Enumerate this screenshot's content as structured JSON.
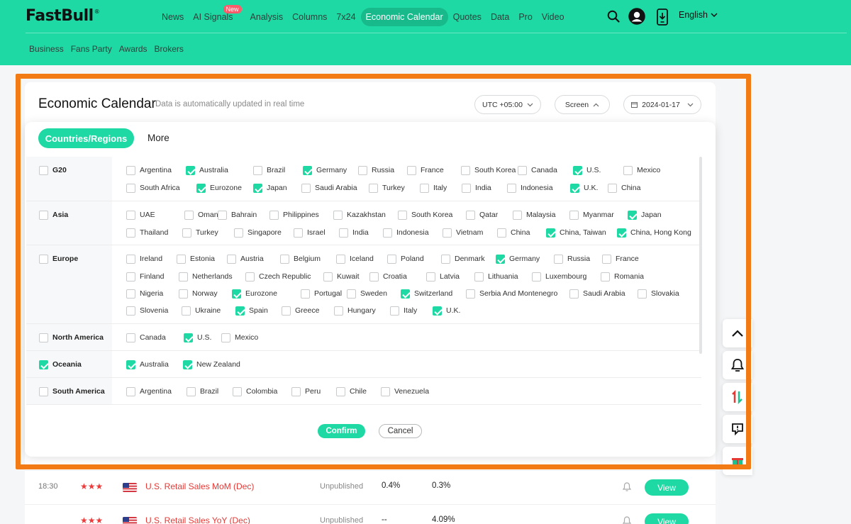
{
  "header": {
    "logo": "FastBull",
    "logo_mark": "®",
    "nav": [
      {
        "label": "News"
      },
      {
        "label": "AI Signals",
        "badge": "New"
      },
      {
        "label": "Analysis"
      },
      {
        "label": "Columns"
      },
      {
        "label": "7x24"
      },
      {
        "label": "Economic Calendar",
        "active": true
      },
      {
        "label": "Quotes"
      },
      {
        "label": "Data"
      },
      {
        "label": "Pro"
      },
      {
        "label": "Video"
      }
    ],
    "language": "English",
    "subnav": [
      "Business",
      "Fans Party",
      "Awards",
      "Brokers"
    ],
    "icons": [
      "search-icon",
      "user-avatar-icon",
      "download-app-icon",
      "chevron-down-icon"
    ]
  },
  "page": {
    "title": "Economic Calendar",
    "subtitle": "Data is automatically updated in real time",
    "timezone": "UTC +05:00",
    "screen_label": "Screen",
    "date": "2024-01-17"
  },
  "filter": {
    "tabs": [
      "Countries/Regions",
      "More"
    ],
    "active_tab": "Countries/Regions",
    "groups": [
      {
        "name": "G20",
        "checked": false,
        "rows": [
          [
            [
              "Argentina",
              false
            ],
            [
              "Australia",
              true
            ],
            [
              "Brazil",
              false
            ],
            [
              "Germany",
              true
            ],
            [
              "Russia",
              false
            ],
            [
              "France",
              false
            ],
            [
              "South Korea",
              false
            ],
            [
              "Canada",
              false
            ],
            [
              "U.S.",
              true
            ],
            [
              "Mexico",
              false
            ]
          ],
          [
            [
              "South Africa",
              false
            ],
            [
              "Eurozone",
              true
            ],
            [
              "Japan",
              true
            ],
            [
              "Saudi Arabia",
              false
            ],
            [
              "Turkey",
              false
            ],
            [
              "Italy",
              false
            ],
            [
              "India",
              false
            ],
            [
              "Indonesia",
              false
            ],
            [
              "U.K.",
              true
            ],
            [
              "China",
              false
            ]
          ]
        ]
      },
      {
        "name": "Asia",
        "checked": false,
        "rows": [
          [
            [
              "UAE",
              false
            ],
            [
              "Oman",
              false
            ],
            [
              "Bahrain",
              false
            ],
            [
              "Philippines",
              false
            ],
            [
              "Kazakhstan",
              false
            ],
            [
              "South Korea",
              false
            ],
            [
              "Qatar",
              false
            ],
            [
              "Malaysia",
              false
            ],
            [
              "Myanmar",
              false
            ],
            [
              "Japan",
              true
            ]
          ],
          [
            [
              "Thailand",
              false
            ],
            [
              "Turkey",
              false
            ],
            [
              "Singapore",
              false
            ],
            [
              "Israel",
              false
            ],
            [
              "India",
              false
            ],
            [
              "Indonesia",
              false
            ],
            [
              "Vietnam",
              false
            ],
            [
              "China",
              false
            ],
            [
              "China, Taiwan",
              true
            ],
            [
              "China, Hong Kong",
              true
            ]
          ]
        ]
      },
      {
        "name": "Europe",
        "checked": false,
        "rows": [
          [
            [
              "Ireland",
              false
            ],
            [
              "Estonia",
              false
            ],
            [
              "Austria",
              false
            ],
            [
              "Belgium",
              false
            ],
            [
              "Iceland",
              false
            ],
            [
              "Poland",
              false
            ],
            [
              "Denmark",
              false
            ],
            [
              "Germany",
              true
            ],
            [
              "Russia",
              false
            ],
            [
              "France",
              false
            ]
          ],
          [
            [
              "Finland",
              false
            ],
            [
              "Netherlands",
              false
            ],
            [
              "Czech Republic",
              false
            ],
            [
              "Kuwait",
              false
            ],
            [
              "Croatia",
              false
            ],
            [
              "Latvia",
              false
            ],
            [
              "Lithuania",
              false
            ],
            [
              "Luxembourg",
              false
            ],
            [
              "Romania",
              false
            ]
          ],
          [
            [
              "Nigeria",
              false
            ],
            [
              "Norway",
              false
            ],
            [
              "Eurozone",
              true
            ],
            [
              "Portugal",
              false
            ],
            [
              "Sweden",
              false
            ],
            [
              "Switzerland",
              true
            ],
            [
              "Serbia And Montenegro",
              false
            ],
            [
              "Saudi Arabia",
              false
            ],
            [
              "Slovakia",
              false
            ]
          ],
          [
            [
              "Slovenia",
              false
            ],
            [
              "Ukraine",
              false
            ],
            [
              "Spain",
              true
            ],
            [
              "Greece",
              false
            ],
            [
              "Hungary",
              false
            ],
            [
              "Italy",
              false
            ],
            [
              "U.K.",
              true
            ]
          ]
        ]
      },
      {
        "name": "North America",
        "checked": false,
        "rows": [
          [
            [
              "Canada",
              false
            ],
            [
              "U.S.",
              true
            ],
            [
              "Mexico",
              false
            ]
          ]
        ]
      },
      {
        "name": "Oceania",
        "checked": true,
        "rows": [
          [
            [
              "Australia",
              true
            ],
            [
              "New Zealand",
              true
            ]
          ]
        ]
      },
      {
        "name": "South America",
        "checked": false,
        "rows": [
          [
            [
              "Argentina",
              false
            ],
            [
              "Brazil",
              false
            ],
            [
              "Colombia",
              false
            ],
            [
              "Peru",
              false
            ],
            [
              "Chile",
              false
            ],
            [
              "Venezuela",
              false
            ]
          ]
        ]
      }
    ],
    "confirm_label": "Confirm",
    "cancel_label": "Cancel"
  },
  "events": [
    {
      "time": "18:30",
      "stars": "★★★",
      "flag": "us-flag-icon",
      "name": "U.S. Retail Sales MoM (Dec)",
      "status": "Unpublished",
      "v1": "0.4%",
      "v2": "0.3%",
      "action": "View"
    },
    {
      "time": "",
      "stars": "★★★",
      "flag": "us-flag-icon",
      "name": "U.S. Retail Sales YoY (Dec)",
      "status": "Unpublished",
      "v1": "--",
      "v2": "4.09%",
      "action": "View"
    }
  ],
  "colors": {
    "brand": "#1ed9a4",
    "highlight": "#f37b16",
    "event_red": "#e53935"
  }
}
